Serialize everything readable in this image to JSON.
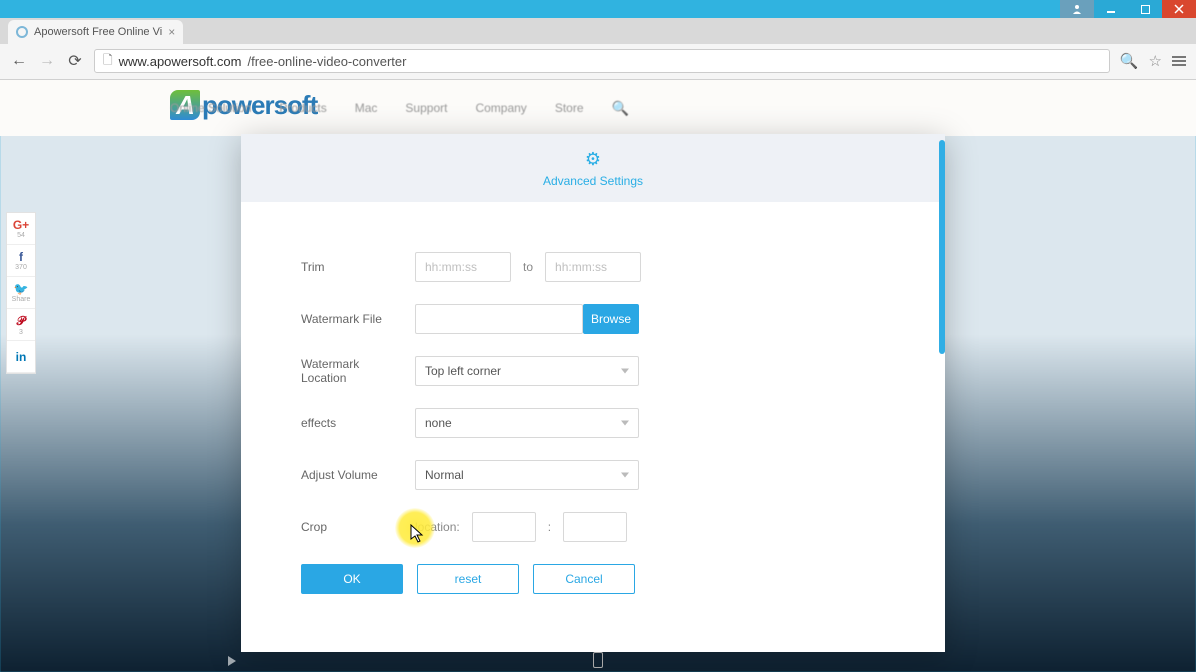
{
  "os": {
    "user_icon": "user",
    "min_icon": "minimize",
    "max_icon": "maximize",
    "close_icon": "close"
  },
  "browser": {
    "tab_title": "Apowersoft Free Online Vi",
    "url_host": "www.apowersoft.com",
    "url_path": "/free-online-video-converter"
  },
  "site_nav": {
    "brand": "powersoft",
    "items": [
      "Online Solution",
      "Products",
      "Mac",
      "Support",
      "Company",
      "Store"
    ]
  },
  "share": {
    "gplus_count": "54",
    "fb_count": "370",
    "tw_label": "Share",
    "pin_count": "3",
    "lin_label": ""
  },
  "modal": {
    "title": "Advanced Settings",
    "trim": {
      "label": "Trim",
      "from_placeholder": "hh:mm:ss",
      "to_label": "to",
      "to_placeholder": "hh:mm:ss"
    },
    "watermark_file": {
      "label": "Watermark File",
      "browse": "Browse",
      "value": ""
    },
    "watermark_location": {
      "label": "Watermark Location",
      "value": "Top left corner"
    },
    "effects": {
      "label": "effects",
      "value": "none"
    },
    "volume": {
      "label": "Adjust Volume",
      "value": "Normal"
    },
    "crop": {
      "label": "Crop",
      "location_label": "location:",
      "loc_a": "",
      "loc_b": ""
    },
    "actions": {
      "ok": "OK",
      "reset": "reset",
      "cancel": "Cancel"
    }
  }
}
